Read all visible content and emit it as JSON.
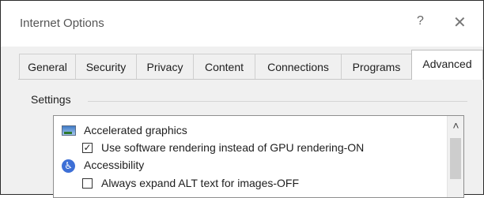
{
  "window": {
    "title": "Internet Options",
    "help_glyph": "?",
    "close_glyph": "✕"
  },
  "tabs": [
    {
      "label": "General",
      "active": false
    },
    {
      "label": "Security",
      "active": false
    },
    {
      "label": "Privacy",
      "active": false
    },
    {
      "label": "Content",
      "active": false
    },
    {
      "label": "Connections",
      "active": false
    },
    {
      "label": "Programs",
      "active": false
    },
    {
      "label": "Advanced",
      "active": true
    }
  ],
  "settings": {
    "group_label": "Settings",
    "items": [
      {
        "type": "category",
        "icon": "monitor-icon",
        "label": "Accelerated graphics"
      },
      {
        "type": "option",
        "checked": true,
        "label": "Use software rendering instead of GPU rendering-ON"
      },
      {
        "type": "category",
        "icon": "accessibility-icon",
        "label": "Accessibility"
      },
      {
        "type": "option",
        "checked": false,
        "label": "Always expand ALT text for images-OFF"
      }
    ]
  },
  "glyphs": {
    "checkmark": "✓",
    "scroll_up": "˄",
    "accessibility_symbol": "♿"
  },
  "colors": {
    "dialog_background": "#f0f0f0",
    "accessibility_icon": "#3d6fd6"
  }
}
